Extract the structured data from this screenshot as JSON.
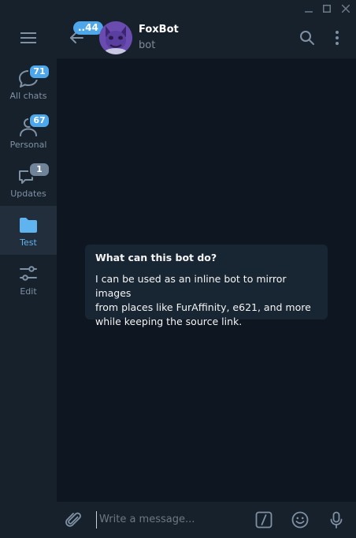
{
  "window": {
    "controls": [
      "minimize-icon",
      "maximize-icon",
      "close-icon"
    ]
  },
  "sidebar": {
    "menu_icon": "hamburger-icon",
    "folders": [
      {
        "label": "All chats",
        "icon": "chats-icon",
        "badge": "71",
        "active": false
      },
      {
        "label": "Personal",
        "icon": "person-icon",
        "badge": "67",
        "active": false
      },
      {
        "label": "Updates",
        "icon": "updates-icon",
        "badge": "1",
        "badge_muted": true,
        "active": false
      },
      {
        "label": "Test",
        "icon": "folder-icon",
        "badge": "",
        "active": true
      },
      {
        "label": "Edit",
        "icon": "sliders-icon",
        "badge": "",
        "active": false
      }
    ]
  },
  "header": {
    "back_badge": "..44",
    "title": "FoxBot",
    "status": "bot",
    "icons": [
      "search-icon",
      "more-icon"
    ]
  },
  "bot_info": {
    "title": "What can this bot do?",
    "description": "I can be used as an inline bot to mirror images\nfrom places like FurAffinity, e621, and more\nwhile keeping the source link."
  },
  "composer": {
    "placeholder": "Write a message...",
    "icons": [
      "attach-icon",
      "bot-commands-icon",
      "emoji-icon",
      "microphone-icon"
    ]
  },
  "colors": {
    "background": "#0e1621",
    "panel": "#17212b",
    "accent": "#4da7ea",
    "active_folder": "#232e3c",
    "bubble": "#182533"
  }
}
